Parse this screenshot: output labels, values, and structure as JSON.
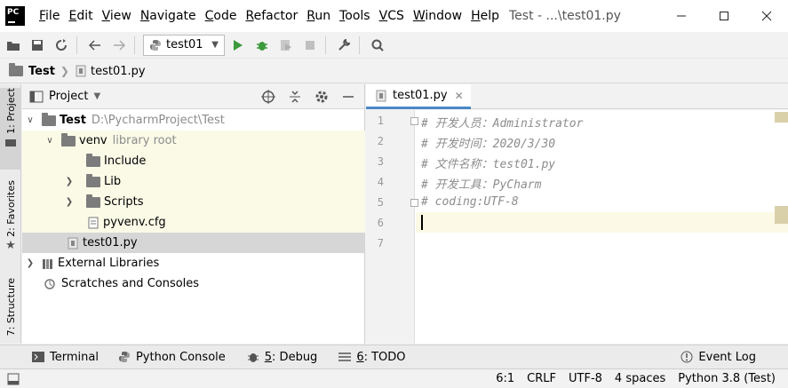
{
  "app": {
    "logo_text": "PC",
    "window_title": "Test - ...\\test01.py"
  },
  "menu": [
    {
      "underline": "F",
      "rest": "ile"
    },
    {
      "underline": "E",
      "rest": "dit"
    },
    {
      "underline": "V",
      "rest": "iew"
    },
    {
      "underline": "N",
      "rest": "avigate"
    },
    {
      "underline": "C",
      "rest": "ode"
    },
    {
      "underline": "R",
      "rest": "efactor"
    },
    {
      "underline": "R",
      "rest": "un"
    },
    {
      "underline": "T",
      "rest": "ools"
    },
    {
      "underline": "V",
      "rest": "CS"
    },
    {
      "underline": "W",
      "rest": "indow"
    },
    {
      "underline": "H",
      "rest": "elp"
    }
  ],
  "toolbar": {
    "run_config": "test01"
  },
  "breadcrumb": {
    "project": "Test",
    "file": "test01.py"
  },
  "left_strip": {
    "project_tab": "1: Project",
    "favorites_tab": "2: Favorites",
    "structure_tab": "7: Structure"
  },
  "project_panel": {
    "title": "Project",
    "tree": {
      "root_name": "Test",
      "root_path": "D:\\PycharmProject\\Test",
      "venv_name": "venv",
      "venv_note": "library root",
      "include": "Include",
      "lib": "Lib",
      "scripts": "Scripts",
      "pyvenv": "pyvenv.cfg",
      "file": "test01.py",
      "external": "External Libraries",
      "scratches": "Scratches and Consoles"
    }
  },
  "editor": {
    "tab_label": "test01.py",
    "line_numbers": [
      "1",
      "2",
      "3",
      "4",
      "5",
      "6",
      "7"
    ],
    "lines": [
      "# 开发人员：Administrator",
      "# 开发时间：2020/3/30",
      "# 文件名称：test01.py",
      "# 开发工具：PyCharm",
      "# coding:UTF-8"
    ]
  },
  "bottom_tabs": {
    "terminal": "Terminal",
    "python_console": "Python Console",
    "debug_num": "5",
    "debug_label": ": Debug",
    "todo_num": "6",
    "todo_label": ": TODO",
    "event_log": "Event Log"
  },
  "statusbar": {
    "position": "6:1",
    "line_sep": "CRLF",
    "encoding": "UTF-8",
    "indent": "4 spaces",
    "interpreter": "Python 3.8 (Test)"
  }
}
